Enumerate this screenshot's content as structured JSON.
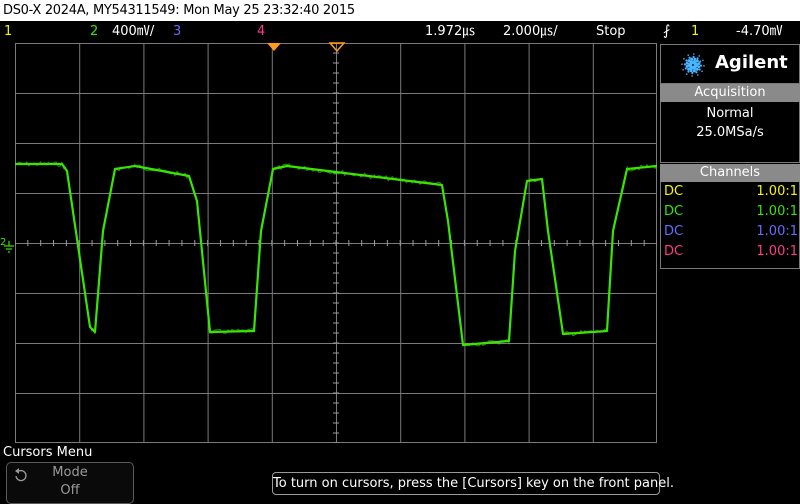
{
  "title": "DS0-X 2024A, MY54311549: Mon May 25 23:32:40 2015",
  "status": {
    "ch1": "1",
    "ch2": "2",
    "ch2_scale": "400㎷/",
    "ch3": "3",
    "ch4": "4",
    "time_delay": "1.972㎲",
    "time_scale": "2.000㎲/",
    "run_state": "Stop",
    "trigger_icon": "⨏",
    "trigger_channel": "1",
    "trigger_level": "-4.70㎷"
  },
  "colors": {
    "ch1": "#f5f500",
    "ch2": "#39e600",
    "ch3": "#6a6aff",
    "ch4": "#ff3a8a",
    "marker": "#ff9a1a",
    "grid": "#7a7a7a"
  },
  "brand": {
    "name": "Agilent",
    "logo_icon": "agilent-spark-icon"
  },
  "acquisition": {
    "header": "Acquisition",
    "mode": "Normal",
    "rate": "25.0MSa/s"
  },
  "channels": {
    "header": "Channels",
    "rows": [
      {
        "coupling": "DC",
        "probe": "1.00:1"
      },
      {
        "coupling": "DC",
        "probe": "1.00:1"
      },
      {
        "coupling": "DC",
        "probe": "1.00:1"
      },
      {
        "coupling": "DC",
        "probe": "1.00:1"
      }
    ]
  },
  "ground_marker": "2",
  "menu": {
    "title": "Cursors Menu",
    "softkey_label": "Mode",
    "softkey_value": "Off",
    "softkey_icon": "rotate-knob-icon"
  },
  "message": "To turn on cursors, press the [Cursors] key on the front panel."
}
